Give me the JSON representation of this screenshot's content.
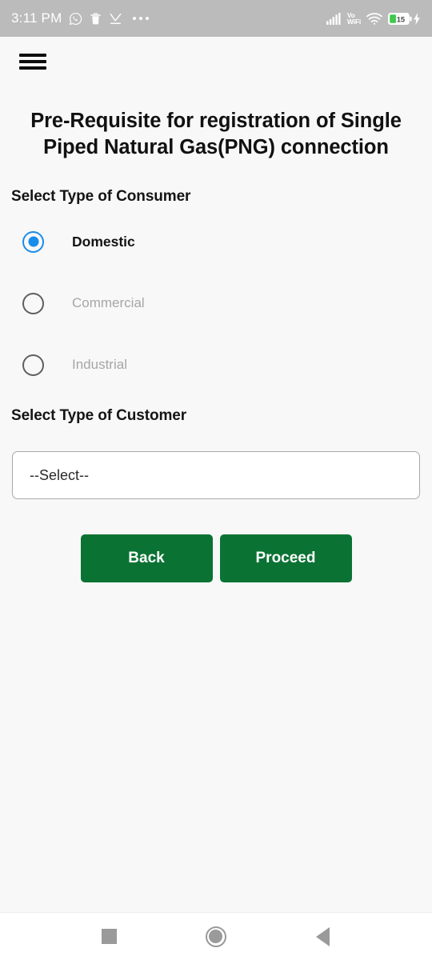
{
  "status_bar": {
    "time": "3:11 PM",
    "left_icons": [
      "whatsapp-icon",
      "trash-icon",
      "download-complete-icon",
      "more-dots-icon"
    ],
    "right_icons": [
      "signal-bars-icon",
      "volte-icon",
      "wifi-icon",
      "battery-icon",
      "charging-bolt-icon"
    ],
    "volte_line1": "Vo",
    "volte_line2": "WiFi",
    "battery_level": "15",
    "colors": {
      "bar_background": "#BBBBBB",
      "icon": "#FFFFFF",
      "battery_fill": "#3DC94B"
    }
  },
  "app_bar": {
    "menu_icon": "hamburger-menu-icon"
  },
  "main": {
    "title": "Pre-Requisite for registration of Single Piped Natural Gas(PNG) connection",
    "consumer_section": {
      "label": "Select Type of Consumer",
      "options": [
        {
          "label": "Domestic",
          "selected": true,
          "disabled": false
        },
        {
          "label": "Commercial",
          "selected": false,
          "disabled": true
        },
        {
          "label": "Industrial",
          "selected": false,
          "disabled": true
        }
      ]
    },
    "customer_section": {
      "label": "Select Type of Customer",
      "select_value": "--Select--"
    },
    "buttons": {
      "back": "Back",
      "proceed": "Proceed"
    },
    "colors": {
      "accent_radio": "#1A8CEA",
      "button_green": "#0A7334",
      "page_background": "#F8F8F8",
      "disabled_text": "#A6A6A6"
    }
  },
  "nav_bar": {
    "recents": "recents-square-icon",
    "home": "home-circle-icon",
    "back": "back-triangle-icon"
  }
}
